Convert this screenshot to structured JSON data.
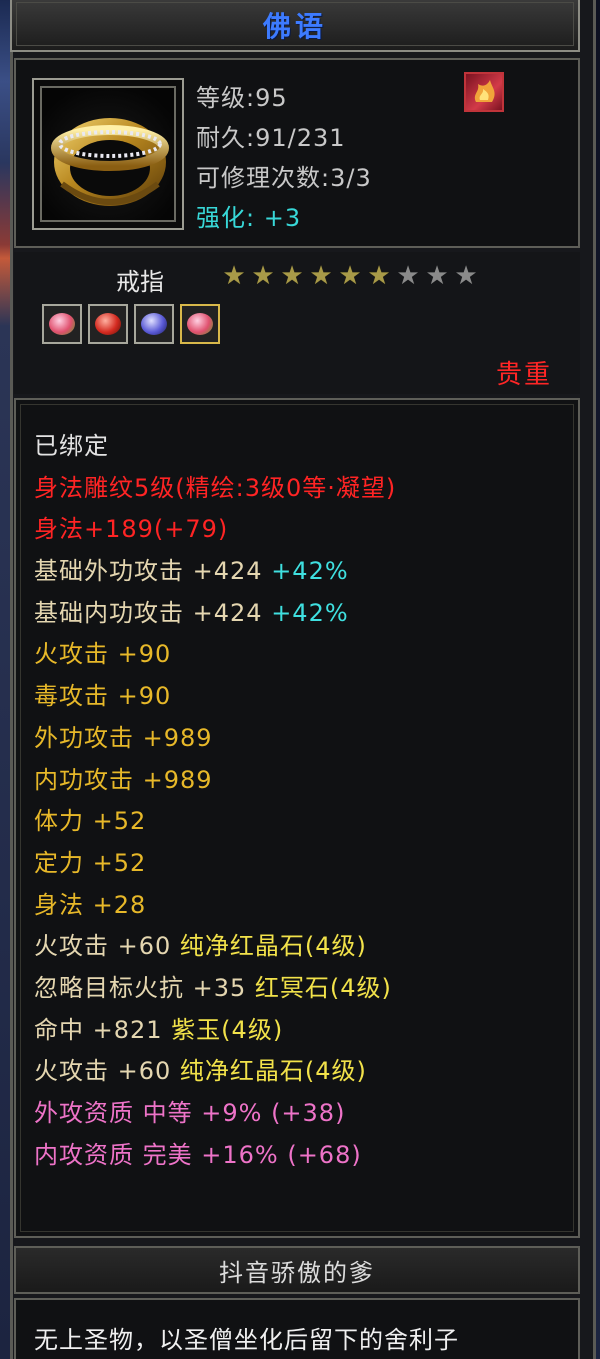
{
  "item": {
    "name": "佛语",
    "level_line": "等级:95",
    "durability_line": "耐久:91/231",
    "repair_line": "可修理次数:3/3",
    "enhance_line": "强化: +3",
    "type": "戒指",
    "rarity": "贵重",
    "stars": {
      "filled": 6,
      "total": 9
    },
    "gem_icons": [
      "pink-gem-icon",
      "red-gem-icon",
      "purple-gem-icon",
      "pink-gem-icon"
    ]
  },
  "attributes": [
    {
      "segments": [
        {
          "text": "已绑定",
          "color": "#e3e3e3"
        }
      ]
    },
    {
      "segments": [
        {
          "text": "身法雕纹5级(精绘:3级0等·凝望)",
          "color": "#ff2424"
        }
      ]
    },
    {
      "segments": [
        {
          "text": "身法+189(+79)",
          "color": "#ff2424"
        }
      ]
    },
    {
      "segments": [
        {
          "text": "基础外功攻击 +424 ",
          "color": "#e4d6b0"
        },
        {
          "text": "+42%",
          "color": "#3fe0e0"
        }
      ]
    },
    {
      "segments": [
        {
          "text": "基础内功攻击 +424 ",
          "color": "#e4d6b0"
        },
        {
          "text": "+42%",
          "color": "#3fe0e0"
        }
      ]
    },
    {
      "segments": [
        {
          "text": "火攻击 +90",
          "color": "#e7b829"
        }
      ]
    },
    {
      "segments": [
        {
          "text": "毒攻击 +90",
          "color": "#e7b829"
        }
      ]
    },
    {
      "segments": [
        {
          "text": "外功攻击 +989",
          "color": "#e7b829"
        }
      ]
    },
    {
      "segments": [
        {
          "text": "内功攻击 +989",
          "color": "#e7b829"
        }
      ]
    },
    {
      "segments": [
        {
          "text": "体力 +52",
          "color": "#e7b829"
        }
      ]
    },
    {
      "segments": [
        {
          "text": "定力 +52",
          "color": "#e7b829"
        }
      ]
    },
    {
      "segments": [
        {
          "text": "身法 +28",
          "color": "#e7b829"
        }
      ]
    },
    {
      "segments": [
        {
          "text": "火攻击 +60 ",
          "color": "#e4d6b0"
        },
        {
          "text": "纯净红晶石(4级)",
          "color": "#f2e24a"
        }
      ]
    },
    {
      "segments": [
        {
          "text": "忽略目标火抗 +35 ",
          "color": "#e4d6b0"
        },
        {
          "text": "红冥石(4级)",
          "color": "#f2e24a"
        }
      ]
    },
    {
      "segments": [
        {
          "text": "命中 +821 ",
          "color": "#e4d6b0"
        },
        {
          "text": "紫玉(4级)",
          "color": "#f2e24a"
        }
      ]
    },
    {
      "segments": [
        {
          "text": "火攻击 +60 ",
          "color": "#e4d6b0"
        },
        {
          "text": "纯净红晶石(4级)",
          "color": "#f2e24a"
        }
      ]
    },
    {
      "segments": [
        {
          "text": "外攻资质  中等 +9% (+38)",
          "color": "#ee73c8"
        }
      ]
    },
    {
      "segments": [
        {
          "text": "内攻资质  完美 +16% (+68)",
          "color": "#ee73c8"
        }
      ]
    }
  ],
  "owner": "抖音骄傲的爹",
  "description": "无上圣物，以圣僧坐化后留下的舍利子",
  "colors": {
    "title": "#3d7bff",
    "enhance": "#38d8d8",
    "rarity": "#ff2626"
  }
}
